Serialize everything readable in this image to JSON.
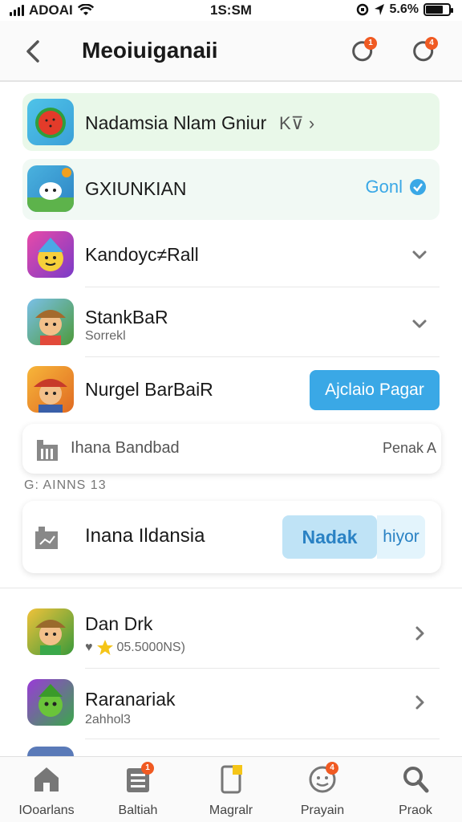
{
  "status_bar": {
    "carrier": "ADOAI",
    "time": "1S:SM",
    "battery": "5.6%",
    "battery_level": 0.75
  },
  "header": {
    "title": "Meoiuiganaii",
    "back_icon": "chevron-left-icon",
    "actions": [
      {
        "icon": "notification-icon",
        "badge": "1"
      },
      {
        "icon": "notification-icon",
        "badge": "4"
      }
    ]
  },
  "rows": [
    {
      "title": "Nadamsia Nlam Gniur",
      "trailing": "K⊽ ›",
      "highlight_color": "#e9f8e9"
    },
    {
      "title": "GXIUNKIAN",
      "action": "Gonl",
      "highlight_color": "#f1f9f4"
    },
    {
      "title": "Kandoyc≠Rall"
    },
    {
      "title": "StankBaR",
      "subtitle": "Sorrekl"
    },
    {
      "title": "Nurgel BarBaiR",
      "action": "Ajclaio Pagar"
    }
  ],
  "search_card": {
    "label": "Ihana Bandbad",
    "trailing": "Penak A"
  },
  "section_label": "G: AINNS  13",
  "feature_card": {
    "title": "Inana Ildansia",
    "primary_button": "Nadak",
    "secondary_button": "hiyor"
  },
  "lower_rows": [
    {
      "title": "Dan Drk",
      "subtitle": "05.5000NS)",
      "rating_prefix": "♥"
    },
    {
      "title": "Raranariak",
      "subtitle": "2ahhol3"
    }
  ],
  "tabs": [
    {
      "label": "IOoarlans",
      "icon": "home-icon"
    },
    {
      "label": "Baltiah",
      "icon": "list-icon",
      "badge": "1"
    },
    {
      "label": "Magralr",
      "icon": "document-icon"
    },
    {
      "label": "Prayain",
      "icon": "profile-icon",
      "badge": "4"
    },
    {
      "label": "Praok",
      "icon": "search-icon"
    }
  ],
  "colors": {
    "accent": "#3aa8e6",
    "badge": "#f05a22",
    "highlight_green": "#e9f8e9"
  }
}
